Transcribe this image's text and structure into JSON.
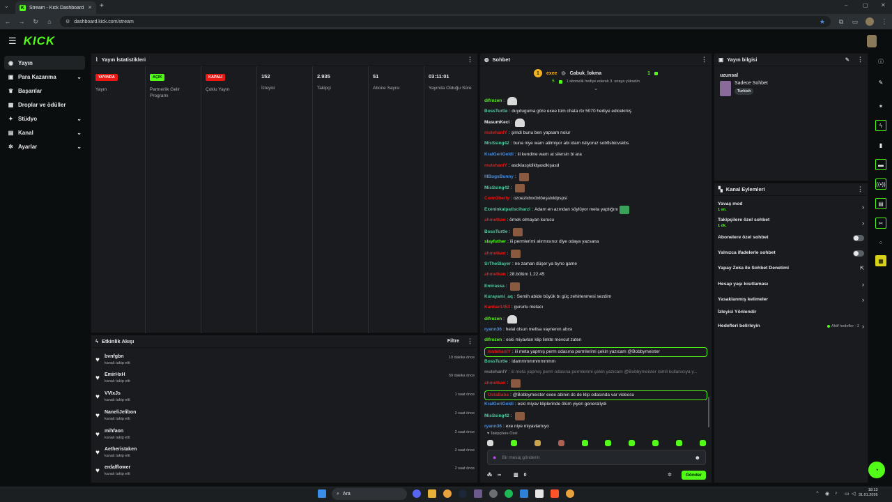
{
  "browser": {
    "tab_title": "Stream - Kick Dashboard",
    "url": "dashboard.kick.com/stream"
  },
  "brand": {
    "logo": "KICK",
    "accent": "#53fc18"
  },
  "sidebar": {
    "items": [
      {
        "label": "Yayın",
        "icon": "broadcast-icon",
        "active": true,
        "expand": false
      },
      {
        "label": "Para Kazanma",
        "icon": "money-icon",
        "expand": true
      },
      {
        "label": "Başarılar",
        "icon": "trophy-icon",
        "expand": false
      },
      {
        "label": "Droplar ve ödüller",
        "icon": "gift-icon",
        "expand": false
      },
      {
        "label": "Stüdyo",
        "icon": "studio-icon",
        "expand": true
      },
      {
        "label": "Kanal",
        "icon": "channel-icon",
        "expand": true
      },
      {
        "label": "Ayarlar",
        "icon": "gear-icon",
        "expand": true
      }
    ]
  },
  "stats": {
    "title": "Yayın İstatistikleri",
    "cols": [
      {
        "badge": "YAYINDA",
        "badge_color": "red",
        "label": "Yayın"
      },
      {
        "badge": "AÇIK",
        "badge_color": "green",
        "label": "Partnerlik Gelir Programı"
      },
      {
        "badge": "KAPALI",
        "badge_color": "red",
        "label": "Çoklu Yayın"
      },
      {
        "value": "152",
        "label": "İzleyici"
      },
      {
        "value": "2.935",
        "label": "Takipçi"
      },
      {
        "value": "51",
        "label": "Abone Sayısı"
      },
      {
        "value": "03:11:01",
        "label": "Yayında Olduğu Süre"
      }
    ]
  },
  "events": {
    "title": "Etkinlik Akışı",
    "filter": "Filtre",
    "items": [
      {
        "name": "bvnfgbn",
        "sub": "kanalı takip etti",
        "time": "19 dakika önce"
      },
      {
        "name": "EmirHxH",
        "sub": "kanalı takip etti",
        "time": "59 dakika önce"
      },
      {
        "name": "VVIxJs",
        "sub": "kanalı takip etti",
        "time": "1 saat önce"
      },
      {
        "name": "NaneliJelibon",
        "sub": "kanalı takip etti",
        "time": "2 saat önce"
      },
      {
        "name": "mihfaon",
        "sub": "kanalı takip etti",
        "time": "2 saat önce"
      },
      {
        "name": "Aetheristaken",
        "sub": "kanalı takip etti",
        "time": "2 saat önce"
      },
      {
        "name": "erdalflower",
        "sub": "kanalı takip etti",
        "time": "2 saat önce"
      }
    ]
  },
  "chat": {
    "title": "Sohbet",
    "pinned": {
      "leader1": "exee",
      "leader1_count": "5",
      "leader2": "Cabuk_lokma",
      "leader2_count": "1",
      "subtitle": "1 abonelik hediye ederek 3. sıraya yükselin"
    },
    "messages": [
      {
        "user": "difrozen",
        "color": "#53fc18",
        "text": "",
        "emote": "white"
      },
      {
        "user": "BossTurtle",
        "color": "#53c9a0",
        "text": "duyduguma göre exee tüm chata rtx 5070 hediye edicekmiş"
      },
      {
        "user": "MasumKeci",
        "color": "#e6e8ea",
        "text": "",
        "emote": "white"
      },
      {
        "user": "mstehanlY",
        "color": "#e91916",
        "text": "şimdi bunu ben yapsam noiur"
      },
      {
        "user": "MisSsing42",
        "color": "#53c9a0",
        "text": "buna niye warn atilmiyor abi idam istiyoruz sobflsbicvskbs"
      },
      {
        "user": "KralGeriGeldi",
        "color": "#4a90e2",
        "text": "iii kendine warn at silersin bi ara"
      },
      {
        "user": "mstehanlY",
        "color": "#e91916",
        "text": "asdkiasşldiklşasdkişasd"
      },
      {
        "user": "IIIBugsBunny",
        "color": "#4a90e2",
        "text": "",
        "emote": "img"
      },
      {
        "user": "MisSsing42",
        "color": "#53c9a0",
        "text": "",
        "emote": "img"
      },
      {
        "user": "Conn3herty",
        "color": "#e91916",
        "text": "ozoezlxlxxöxlöeşslxldpspsl"
      },
      {
        "user": "Exeninkalpatisciharzi",
        "color": "#53c9a0",
        "text": "Adam en azından söylüyor meta yaptığını",
        "emote": "green"
      },
      {
        "user": "ahmetkan",
        "color": "#e91916",
        "text": "örnek olmayan kurucu"
      },
      {
        "user": "BossTurtle",
        "color": "#53c9a0",
        "text": "",
        "emote": "img"
      },
      {
        "user": "slayfuther",
        "color": "#53fc18",
        "text": "iii permlerimi alırmısınız diye odaya yazsana"
      },
      {
        "user": "ahmetkan",
        "color": "#e91916",
        "text": "",
        "emote": "img"
      },
      {
        "user": "SrTheSlayer",
        "color": "#53c9a0",
        "text": "ne zaman düşer ya byno game"
      },
      {
        "user": "ahmetkan",
        "color": "#e91916",
        "text": "28.bölüm 1.22.45"
      },
      {
        "user": "Emirassa",
        "color": "#53c9a0",
        "text": "",
        "emote": "img"
      },
      {
        "user": "Kurayami_aq",
        "color": "#53c9a0",
        "text": "Semih abide büyük bı güç zehirlenmesi sezdim"
      },
      {
        "user": "Kanbar1453",
        "color": "#e91916",
        "text": "gururlu metacı"
      },
      {
        "user": "difrozen",
        "color": "#53fc18",
        "text": "",
        "emote": "white"
      },
      {
        "user": "ryann36",
        "color": "#4a90e2",
        "text": "helal olsun melisa vaynenın abısı"
      },
      {
        "user": "difrozen",
        "color": "#53fc18",
        "text": "eski miyavları klip linkte mevcut zaten"
      },
      {
        "user": "mstehanlY",
        "color": "#e91916",
        "text": "iii meta yapmış perm odasına permlerimi çekin yazıcam @Bobbymeister",
        "highlight": true
      },
      {
        "user": "BossTurtle",
        "color": "#53c9a0",
        "text": "idammmmmmmmmm"
      },
      {
        "user": "mstehanlY",
        "color": "#7c8388",
        "text": "iii meta yapmış perm odasına permlerimi çekin yazıcam @Bobbymeister isimli kullanıcıya y...",
        "dim": true
      },
      {
        "user": "ahmetkan",
        "color": "#e91916",
        "text": "",
        "emote": "img"
      },
      {
        "user": "UstaBaba",
        "color": "#e91916",
        "text": "@Bobbymeister exee abinin dc de klip odasında var videosu",
        "highlight": true
      },
      {
        "user": "KralGeriGeldi",
        "color": "#4a90e2",
        "text": "eski miyav kliplerinde ölüm yiyen generallydi"
      },
      {
        "user": "MisSsing42",
        "color": "#53c9a0",
        "text": "",
        "emote": "img"
      },
      {
        "user": "ryann36",
        "color": "#4a90e2",
        "text": "exe niye miyavlamıyo"
      }
    ],
    "followers_only_label": "Takipçilere Özel",
    "input_placeholder": "Bir mesaj gönderin",
    "footer_count_a": "∞",
    "footer_count_b": "0",
    "send_label": "Gönder"
  },
  "stream_info": {
    "title": "Yayın bilgisi",
    "stream_title": "uzunsal",
    "category": "Sadece Sohbet",
    "tag": "Turkish"
  },
  "channel_actions": {
    "title": "Kanal Eylemleri",
    "items": [
      {
        "label": "Yavaş mod",
        "sub": "1 sn.",
        "control": "chevron"
      },
      {
        "label": "Takipçilere özel sohbet",
        "sub": "1 dk.",
        "control": "chevron"
      },
      {
        "label": "Abonelere özel sohbet",
        "control": "toggle"
      },
      {
        "label": "Yalnızca ifadelerle sohbet",
        "control": "toggle"
      },
      {
        "label": "Yapay Zeka ile Sohbet Denetimi",
        "control": "external"
      },
      {
        "label": "Hesap yaşı kısıtlaması",
        "control": "chevron"
      },
      {
        "label": "Yasaklanmış kelimeler",
        "control": "chevron"
      },
      {
        "label": "İzleyici Yönlendir",
        "control": "none"
      },
      {
        "label": "Hedefleri belirleyin",
        "goal": "Aktif hedefler - 2",
        "control": "chevron"
      }
    ]
  },
  "taskbar": {
    "search_placeholder": "Ara",
    "time": "18:13",
    "date": "31.01.2026"
  }
}
